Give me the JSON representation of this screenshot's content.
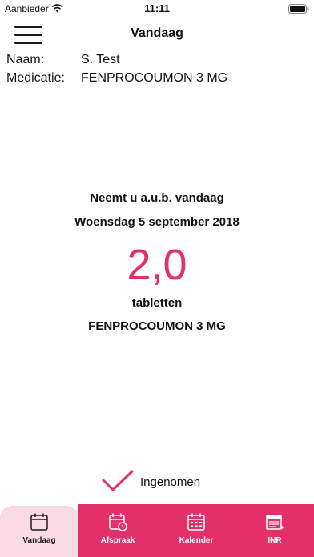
{
  "status_bar": {
    "carrier": "Aanbieder",
    "time": "11:11",
    "icons": [
      "wifi-icon",
      "battery-icon"
    ]
  },
  "nav": {
    "title": "Vandaag",
    "menu_icon": "hamburger-menu-icon"
  },
  "patient": {
    "name_label": "Naam:",
    "name_value": "S. Test",
    "med_label": "Medicatie:",
    "med_value": "FENPROCOUMON 3 MG"
  },
  "dose": {
    "instruction": "Neemt u a.u.b. vandaag",
    "date": "Woensdag 5 september 2018",
    "amount": "2,0",
    "unit": "tabletten",
    "medication": "FENPROCOUMON 3 MG"
  },
  "taken": {
    "label": "Ingenomen",
    "icon": "checkmark-icon"
  },
  "tabs": [
    {
      "label": "Vandaag",
      "icon": "calendar-icon",
      "active": true
    },
    {
      "label": "Afspraak",
      "icon": "calendar-clock-icon",
      "active": false
    },
    {
      "label": "Kalender",
      "icon": "calendar-grid-icon",
      "active": false
    },
    {
      "label": "INR",
      "icon": "inr-log-icon",
      "active": false
    }
  ],
  "colors": {
    "accent": "#e3306b",
    "text": "#111111",
    "tab_active_bg": "#f9dbe6",
    "background": "#ffffff"
  }
}
